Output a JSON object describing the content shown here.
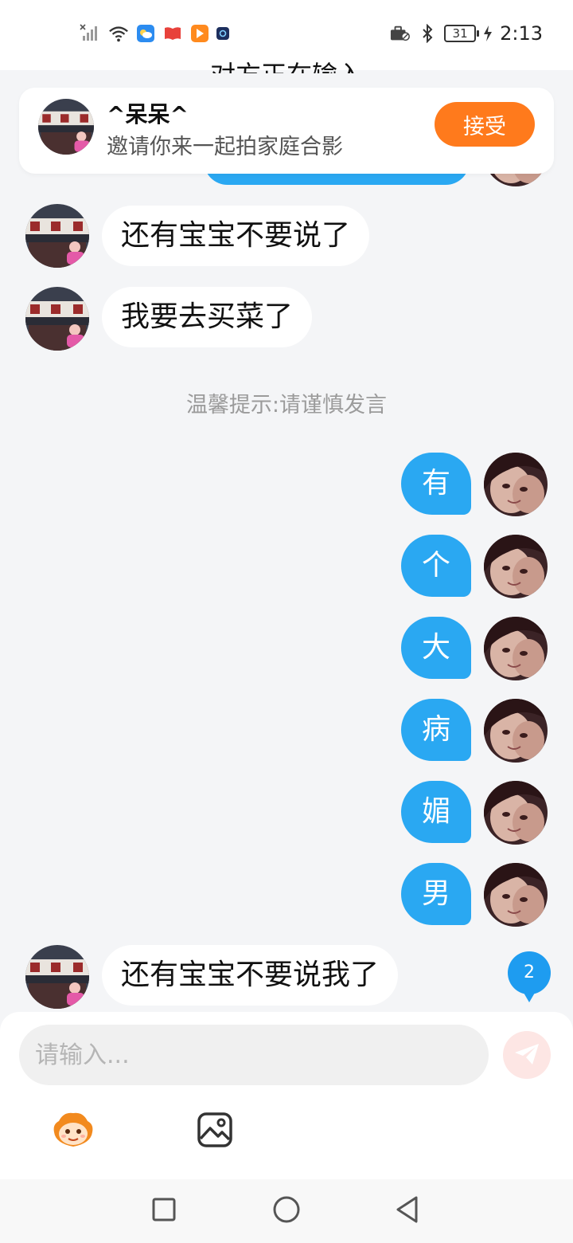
{
  "status_bar": {
    "time": "2:13",
    "battery": "31",
    "icons": [
      "no-signal-icon",
      "wifi-icon",
      "weather-app-icon",
      "reading-app-icon",
      "video-app-icon",
      "app-icon",
      "briefcase-icon",
      "bluetooth-icon",
      "battery-icon",
      "charging-icon"
    ]
  },
  "header": {
    "title": "对方正在输入"
  },
  "invite": {
    "name": "^呆呆^",
    "message": "邀请你来一起拍家庭合影",
    "accept_label": "接受",
    "accent_color": "#ff7a1c"
  },
  "messages_left": [
    {
      "text": "还有宝宝不要说了"
    },
    {
      "text": "我要去买菜了"
    },
    {
      "text": "还有宝宝不要说我了"
    }
  ],
  "tip": "温馨提示:请谨慎发言",
  "messages_right": [
    {
      "text": "有"
    },
    {
      "text": "个"
    },
    {
      "text": "大"
    },
    {
      "text": "病"
    },
    {
      "text": "媚"
    },
    {
      "text": "男"
    }
  ],
  "unread_count": "2",
  "input": {
    "placeholder": "请输入..."
  },
  "toolbar": {
    "icons": [
      "emoji-mascot-icon",
      "image-icon"
    ]
  },
  "nav": {
    "icons": [
      "recent-apps-icon",
      "home-icon",
      "back-icon"
    ]
  },
  "colors": {
    "sent_bubble": "#2aa8f2",
    "badge": "#1e9cf0",
    "background": "#f4f5f7"
  }
}
